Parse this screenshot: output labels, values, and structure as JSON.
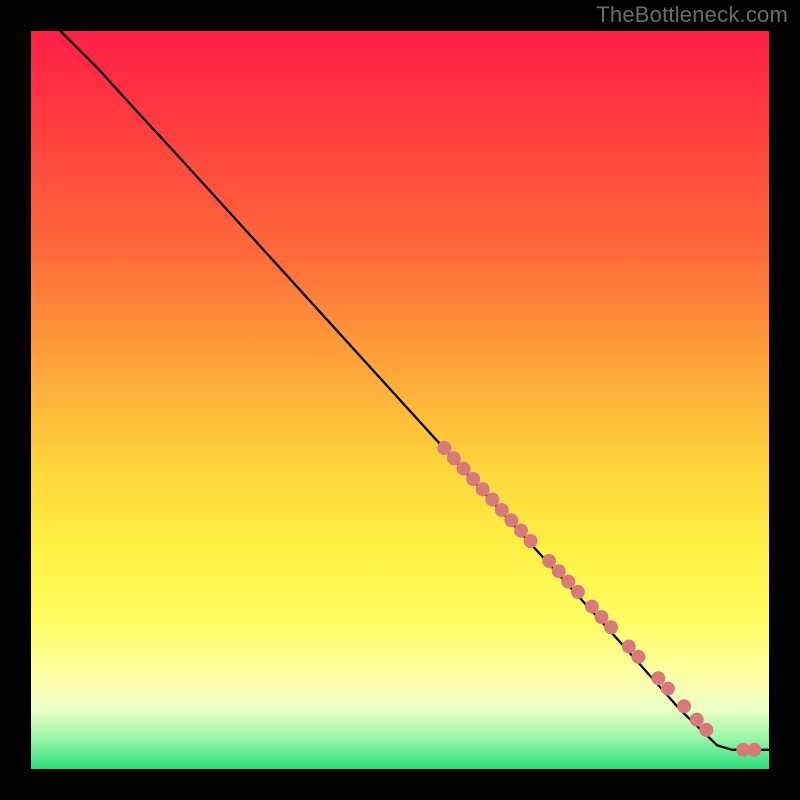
{
  "watermark": "TheBottleneck.com",
  "chart_data": {
    "type": "line",
    "title": "",
    "xlabel": "",
    "ylabel": "",
    "xlim": [
      0,
      100
    ],
    "ylim": [
      0,
      100
    ],
    "curve": [
      {
        "x": 4,
        "y": 100
      },
      {
        "x": 9,
        "y": 95
      },
      {
        "x": 14,
        "y": 89.5
      },
      {
        "x": 20,
        "y": 83
      },
      {
        "x": 30,
        "y": 72
      },
      {
        "x": 40,
        "y": 61
      },
      {
        "x": 50,
        "y": 50
      },
      {
        "x": 60,
        "y": 39
      },
      {
        "x": 70,
        "y": 28
      },
      {
        "x": 80,
        "y": 17
      },
      {
        "x": 88,
        "y": 8
      },
      {
        "x": 93,
        "y": 3.2
      },
      {
        "x": 95,
        "y": 2.6
      },
      {
        "x": 97,
        "y": 2.6
      },
      {
        "x": 100,
        "y": 2.6
      }
    ],
    "dots": [
      {
        "x": 56.0,
        "y": 43.5
      },
      {
        "x": 57.3,
        "y": 42.1
      },
      {
        "x": 58.6,
        "y": 40.7
      },
      {
        "x": 59.9,
        "y": 39.3
      },
      {
        "x": 61.2,
        "y": 37.9
      },
      {
        "x": 62.5,
        "y": 36.5
      },
      {
        "x": 63.8,
        "y": 35.1
      },
      {
        "x": 65.1,
        "y": 33.7
      },
      {
        "x": 66.4,
        "y": 32.3
      },
      {
        "x": 67.7,
        "y": 30.9
      },
      {
        "x": 70.2,
        "y": 28.2
      },
      {
        "x": 71.5,
        "y": 26.8
      },
      {
        "x": 72.8,
        "y": 25.4
      },
      {
        "x": 74.1,
        "y": 24.0
      },
      {
        "x": 76.0,
        "y": 22.0
      },
      {
        "x": 77.3,
        "y": 20.6
      },
      {
        "x": 78.6,
        "y": 19.2
      },
      {
        "x": 81.0,
        "y": 16.6
      },
      {
        "x": 82.3,
        "y": 15.2
      },
      {
        "x": 85.0,
        "y": 12.3
      },
      {
        "x": 86.3,
        "y": 10.9
      },
      {
        "x": 88.5,
        "y": 8.5
      },
      {
        "x": 90.2,
        "y": 6.7
      },
      {
        "x": 91.5,
        "y": 5.3
      },
      {
        "x": 96.5,
        "y": 2.6
      },
      {
        "x": 98.0,
        "y": 2.6
      }
    ],
    "dot_radius_px": 7,
    "dot_color": "#d97a7a",
    "line_color": "#000000"
  }
}
